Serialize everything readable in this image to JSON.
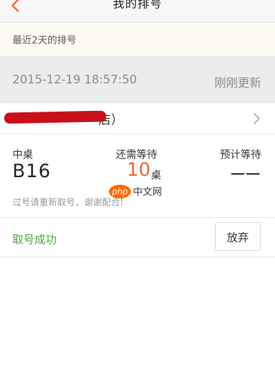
{
  "header": {
    "title": "我的排号",
    "back_icon": "chevron-left-icon",
    "accent_color": "#f0642d"
  },
  "recent": {
    "label": "最近2天的排号"
  },
  "timestamp": {
    "datetime": "2015-12-19 18:57:50",
    "refresh_status": "刚刚更新"
  },
  "store": {
    "name_visible_suffix": "店）",
    "chevron_icon": "chevron-right-icon"
  },
  "queue": {
    "table_type_label": "中桌",
    "queue_number": "B16",
    "wait_label": "还需等待",
    "wait_count": "10",
    "wait_unit": "桌",
    "estimate_label": "预计等待",
    "estimate_value": "一一",
    "note": "过号请重新取号，谢谢配合!",
    "wait_color": "#f0642d"
  },
  "watermark": {
    "oval_text": "php",
    "text": "中文网"
  },
  "actions": {
    "status": "取号成功",
    "status_color": "#4aa33c",
    "abandon_label": "放弃"
  }
}
